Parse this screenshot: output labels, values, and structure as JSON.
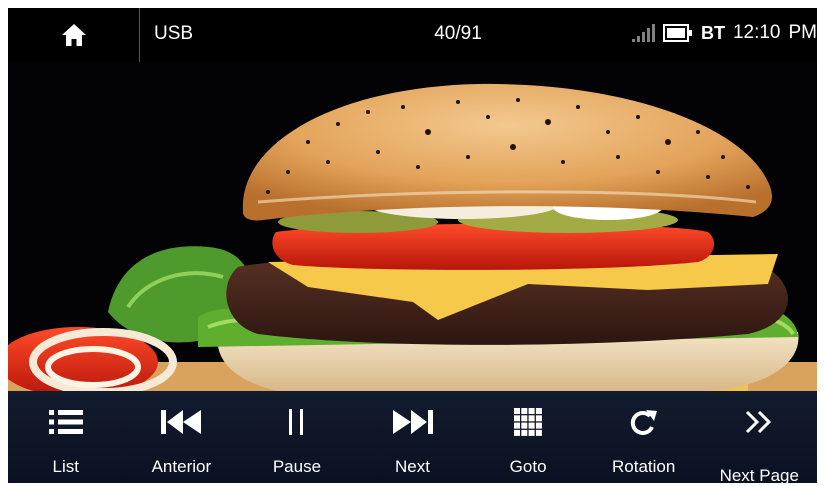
{
  "status_bar": {
    "home_icon": "home-icon",
    "source": "USB",
    "track_counter": "40/91",
    "signal_icon": "signal-bars-icon",
    "battery_icon": "battery-icon",
    "bt": "BT",
    "time": "12:10",
    "ampm": "PM"
  },
  "viewer": {
    "image_icon": "burger-photo"
  },
  "controls": [
    {
      "label": "List",
      "icon": "list-icon"
    },
    {
      "label": "Anterior",
      "icon": "previous-icon"
    },
    {
      "label": "Pause",
      "icon": "pause-icon"
    },
    {
      "label": "Next",
      "icon": "next-icon"
    },
    {
      "label": "Goto",
      "icon": "grid-icon"
    },
    {
      "label": "Rotation",
      "icon": "rotate-icon"
    },
    {
      "label": "Next Page",
      "icon": "double-chevron-right-icon"
    }
  ],
  "colors": {
    "background": "#000000",
    "control_bar": "#0f1729",
    "text": "#ffffff"
  }
}
